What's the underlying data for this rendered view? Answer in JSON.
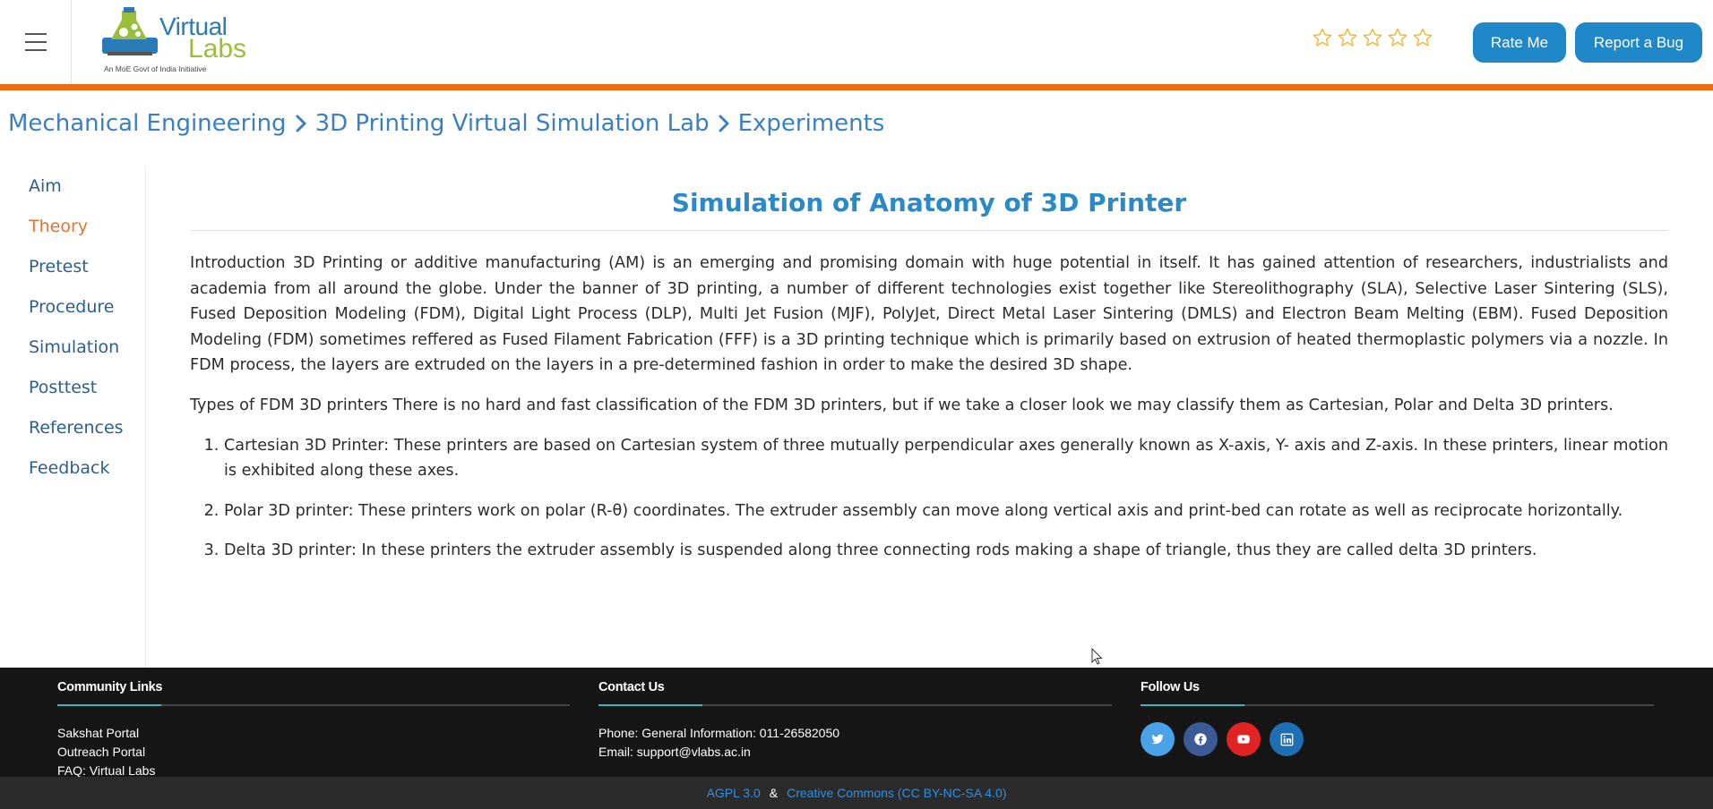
{
  "header": {
    "menu_icon": "hamburger-icon",
    "logo": {
      "text_line1": "Virtual",
      "text_line2": "Labs",
      "tagline": "An MoE Govt of India Initiative"
    },
    "rating": {
      "stars_total": 5,
      "stars_filled": 0,
      "star_color": "#f2b531"
    },
    "rate_button": "Rate Me",
    "bug_button": "Report a Bug",
    "accent_color": "#f06a14",
    "button_color": "#1e88c9"
  },
  "breadcrumb": {
    "items": [
      "Mechanical Engineering",
      "3D Printing Virtual Simulation Lab",
      "Experiments"
    ]
  },
  "sidebar": {
    "items": [
      {
        "label": "Aim",
        "active": false
      },
      {
        "label": "Theory",
        "active": true
      },
      {
        "label": "Pretest",
        "active": false
      },
      {
        "label": "Procedure",
        "active": false
      },
      {
        "label": "Simulation",
        "active": false
      },
      {
        "label": "Posttest",
        "active": false
      },
      {
        "label": "References",
        "active": false
      },
      {
        "label": "Feedback",
        "active": false
      }
    ]
  },
  "main": {
    "title": "Simulation of Anatomy of 3D Printer",
    "intro": "Introduction 3D Printing or additive manufacturing (AM) is an emerging and promising domain with huge potential in itself. It has gained attention of researchers, industrialists and academia from all around the globe. Under the banner of 3D printing, a number of different technologies exist together like Stereolithography (SLA), Selective Laser Sintering (SLS), Fused Deposition Modeling (FDM), Digital Light Process (DLP), Multi Jet Fusion (MJF), PolyJet, Direct Metal Laser Sintering (DMLS) and Electron Beam Melting (EBM). Fused Deposition Modeling (FDM) sometimes reffered as Fused Filament Fabrication (FFF) is a 3D printing technique which is primarily based on extrusion of heated thermoplastic polymers via a nozzle. In FDM process, the layers are extruded on the layers in a pre-determined fashion in order to make the desired 3D shape.",
    "types_intro": "Types of FDM 3D printers There is no hard and fast classification of the FDM 3D printers, but if we take a closer look we may classify them as Cartesian, Polar and Delta 3D printers.",
    "types": [
      "Cartesian 3D Printer: These printers are based on Cartesian system of three mutually perpendicular axes generally known as X-axis, Y- axis and Z-axis. In these printers, linear motion is exhibited along these axes.",
      "Polar 3D printer: These printers work on polar (R-θ) coordinates. The extruder assembly can move along vertical axis and print-bed can rotate as well as reciprocate horizontally.",
      "Delta 3D printer: In these printers the extruder assembly is suspended along three connecting rods making a shape of triangle, thus they are called delta 3D printers."
    ]
  },
  "footer": {
    "community": {
      "heading": "Community Links",
      "links": [
        "Sakshat Portal",
        "Outreach Portal",
        "FAQ: Virtual Labs"
      ]
    },
    "contact": {
      "heading": "Contact Us",
      "phone": "Phone: General Information: 011-26582050",
      "email": "Email: support@vlabs.ac.in"
    },
    "follow": {
      "heading": "Follow Us",
      "icons": [
        {
          "name": "twitter-icon",
          "color": "#4aa3e8"
        },
        {
          "name": "facebook-icon",
          "color": "#3b5a96"
        },
        {
          "name": "youtube-icon",
          "color": "#e02424"
        },
        {
          "name": "linkedin-icon",
          "color": "#1f6fb4"
        }
      ]
    },
    "license_1": "AGPL 3.0",
    "license_sep": "&",
    "license_2": "Creative Commons (CC BY-NC-SA 4.0)"
  }
}
